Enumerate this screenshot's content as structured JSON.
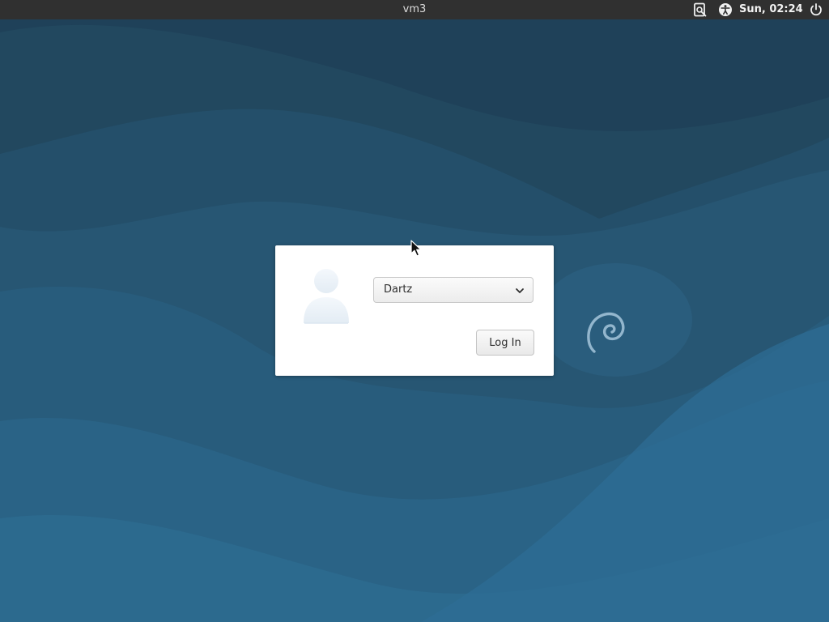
{
  "topbar": {
    "hostname": "vm3",
    "clock": "Sun, 02:24",
    "icons": [
      "screen-keyboard-icon",
      "accessibility-icon",
      "power-icon"
    ]
  },
  "login": {
    "selected_user": "Dartz",
    "login_button_label": "Log In",
    "avatar_icon": "user-avatar-icon",
    "dropdown_icon": "chevron-down-icon"
  },
  "desktop": {
    "logo_icon": "debian-swirl-icon"
  },
  "colors": {
    "topbar_bg": "#303030",
    "wallpaper_dark": "#1f3f58",
    "wallpaper_light": "#2c6a92",
    "card_bg": "#ffffff"
  }
}
